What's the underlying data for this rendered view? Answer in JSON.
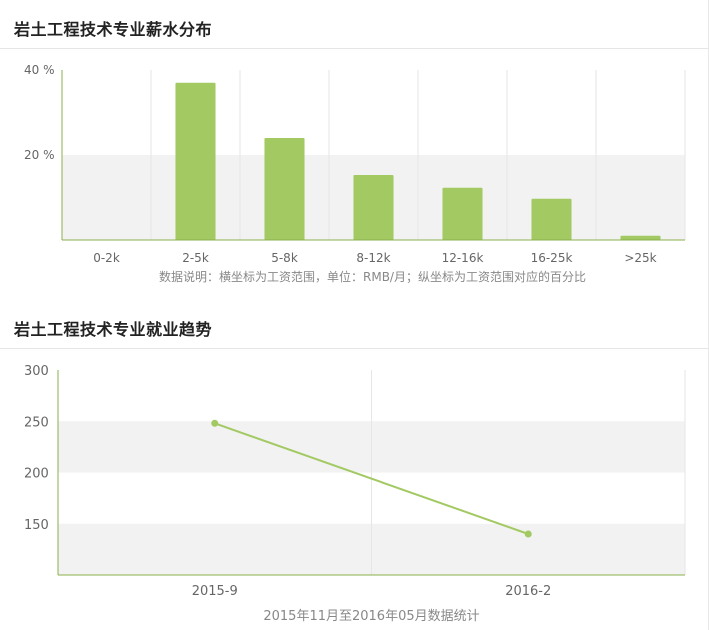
{
  "salary": {
    "title": "岩土工程技术专业薪水分布",
    "note": "数据说明：横坐标为工资范围，单位：RMB/月；纵坐标为工资范围对应的百分比"
  },
  "trend": {
    "title": "岩土工程技术专业就业趋势",
    "note": "2015年11月至2016年05月数据统计"
  },
  "colors": {
    "accent": "#a2c962",
    "axis": "#8ab04c",
    "band": "#f2f2f2",
    "grid": "#e6e6e6"
  },
  "chart_data": [
    {
      "type": "bar",
      "categories": [
        "0-2k",
        "2-5k",
        "5-8k",
        "8-12k",
        "12-16k",
        "16-25k",
        ">25k"
      ],
      "values": [
        0,
        37,
        24,
        15.3,
        12.3,
        9.7,
        1
      ],
      "ylim": [
        0,
        40
      ],
      "yticks": [
        20,
        40
      ],
      "ytick_labels": [
        "20 %",
        "40 %"
      ],
      "grid": true
    },
    {
      "type": "line",
      "categories": [
        "2015-9",
        "2016-2"
      ],
      "values": [
        248,
        140
      ],
      "ylim": [
        100,
        300
      ],
      "yticks": [
        150,
        200,
        250,
        300
      ],
      "ytick_labels": [
        "150",
        "200",
        "250",
        "300"
      ],
      "grid": true
    }
  ]
}
